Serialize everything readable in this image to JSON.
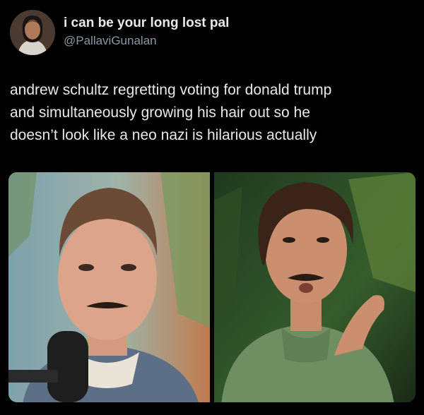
{
  "tweet": {
    "author": {
      "display_name": "i can be your long lost pal",
      "handle": "@PallaviGunalan",
      "avatar_icon": "profile-photo"
    },
    "text": "andrew schultz regretting voting for donald trump\nand simultaneously growing his hair out so he\ndoesn’t look like a neo nazi is hilarious actually",
    "media": [
      {
        "icon": "photo-short-hair-podcast-mic"
      },
      {
        "icon": "photo-long-hair-green-shirt"
      }
    ]
  },
  "colors": {
    "background": "#000000",
    "primary_text": "#e7e9ea",
    "secondary_text": "#8b98a5"
  }
}
